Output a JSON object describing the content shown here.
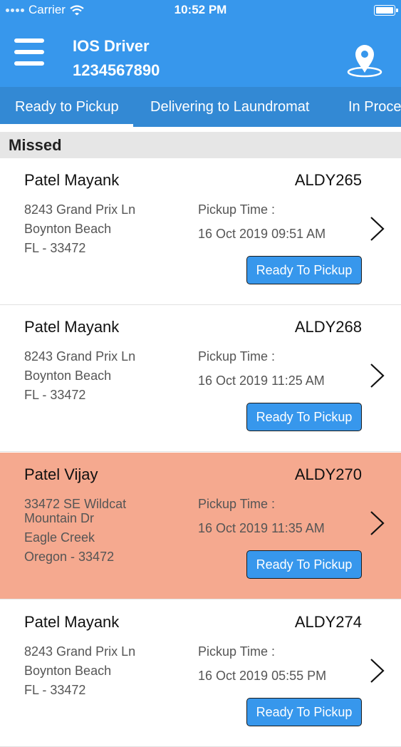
{
  "status_bar": {
    "carrier": "Carrier",
    "time": "10:52 PM"
  },
  "header": {
    "driver_name": "IOS Driver",
    "driver_phone": "1234567890"
  },
  "tabs": [
    {
      "label": "Ready to Pickup",
      "active": true
    },
    {
      "label": "Delivering to Laundromat",
      "active": false
    },
    {
      "label": "In Proce",
      "active": false
    }
  ],
  "section_title": "Missed",
  "orders": [
    {
      "name": "Patel Mayank",
      "order_id": "ALDY265",
      "address": [
        "8243 Grand Prix Ln",
        "Boynton Beach",
        "FL - 33472"
      ],
      "pickup_label": "Pickup Time :",
      "pickup_time": "16 Oct 2019 09:51 AM",
      "button": "Ready To Pickup",
      "highlighted": false
    },
    {
      "name": "Patel Mayank",
      "order_id": "ALDY268",
      "address": [
        "8243 Grand Prix Ln",
        "Boynton Beach",
        "FL - 33472"
      ],
      "pickup_label": "Pickup Time :",
      "pickup_time": "16 Oct 2019 11:25 AM",
      "button": "Ready To Pickup",
      "highlighted": false
    },
    {
      "name": "Patel Vijay",
      "order_id": "ALDY270",
      "address": [
        "33472 SE Wildcat Mountain Dr",
        "Eagle Creek",
        "Oregon - 33472"
      ],
      "pickup_label": "Pickup Time :",
      "pickup_time": "16 Oct 2019 11:35 AM",
      "button": "Ready To Pickup",
      "highlighted": true
    },
    {
      "name": "Patel Mayank",
      "order_id": "ALDY274",
      "address": [
        "8243 Grand Prix Ln",
        "Boynton Beach",
        "FL - 33472"
      ],
      "pickup_label": "Pickup Time :",
      "pickup_time": "16 Oct 2019 05:55 PM",
      "button": "Ready To Pickup",
      "highlighted": false
    }
  ],
  "colors": {
    "primary": "#3797ec",
    "tab_bar": "#3389d4",
    "highlight_row": "#f5a98f"
  },
  "icons": {
    "menu": "hamburger-menu-icon",
    "location": "location-pin-icon",
    "row_action": "chevron-right-icon",
    "wifi": "wifi-icon",
    "battery": "battery-icon"
  }
}
